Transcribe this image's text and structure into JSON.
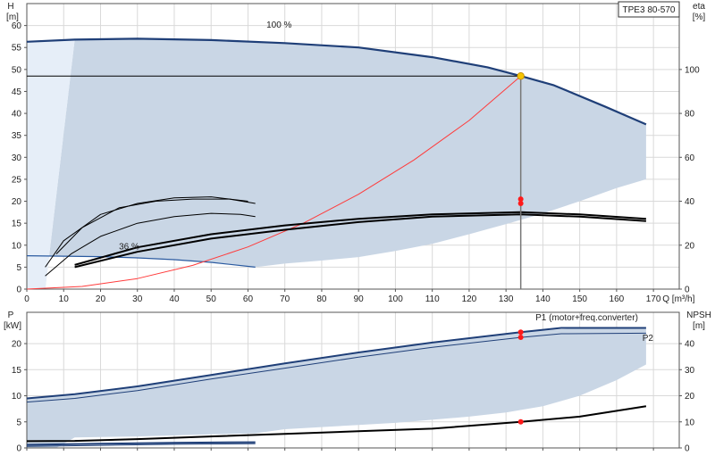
{
  "chart_data": [
    {
      "type": "line",
      "product_label": "TPE3 80-570",
      "ylabel": "H",
      "ylabel_unit": "[m]",
      "y2label": "eta",
      "y2label_unit": "[%]",
      "xlabel": "Q [m³/h]",
      "xlim": [
        0,
        177
      ],
      "ylim": [
        0,
        65
      ],
      "y2lim": [
        0,
        130
      ],
      "xticks": [
        0,
        10,
        20,
        30,
        40,
        50,
        60,
        70,
        80,
        90,
        100,
        110,
        120,
        130,
        140,
        150,
        160,
        170
      ],
      "yticks": [
        0,
        5,
        10,
        15,
        20,
        25,
        30,
        35,
        40,
        45,
        50,
        55,
        60
      ],
      "y2ticks": [
        0,
        20,
        40,
        60,
        80,
        100
      ],
      "grid": true,
      "annotations": [
        {
          "text": "100 %",
          "x": 65,
          "y": 59.5
        },
        {
          "text": "36 %",
          "x": 25,
          "y": 9
        }
      ],
      "operating_point": {
        "x": 134,
        "y": 48.5,
        "color": "#f5c400"
      },
      "operating_area": {
        "color": "#c9d6e5",
        "points": [
          [
            5,
            0
          ],
          [
            13,
            56.8
          ],
          [
            30,
            57
          ],
          [
            50,
            56.7
          ],
          [
            70,
            56
          ],
          [
            90,
            55
          ],
          [
            110,
            52.8
          ],
          [
            125,
            50.5
          ],
          [
            134,
            48.5
          ],
          [
            143,
            46.4
          ],
          [
            157,
            41.5
          ],
          [
            168,
            37.5
          ],
          [
            168,
            25
          ],
          [
            160,
            23
          ],
          [
            150,
            20
          ],
          [
            140,
            17.2
          ],
          [
            130,
            14.8
          ],
          [
            120,
            12.5
          ],
          [
            110,
            10.3
          ],
          [
            100,
            8.7
          ],
          [
            90,
            7.3
          ],
          [
            80,
            6.5
          ],
          [
            70,
            5.8
          ],
          [
            62,
            5
          ],
          [
            50,
            6.1
          ],
          [
            40,
            6.7
          ],
          [
            30,
            7.1
          ],
          [
            20,
            7.4
          ],
          [
            10,
            7.5
          ],
          [
            0,
            7.6
          ],
          [
            0,
            0
          ]
        ]
      },
      "min_area": {
        "color": "#e6eef8",
        "points": [
          [
            0,
            56.3
          ],
          [
            13,
            56.8
          ],
          [
            5,
            0
          ],
          [
            0,
            0
          ]
        ]
      },
      "series": [
        {
          "role": "head_max",
          "axis": "left",
          "color": "#1f3f78",
          "width": 2.2,
          "points": [
            [
              0,
              56.3
            ],
            [
              13,
              56.8
            ],
            [
              30,
              57
            ],
            [
              50,
              56.7
            ],
            [
              70,
              56
            ],
            [
              90,
              55
            ],
            [
              110,
              52.8
            ],
            [
              125,
              50.5
            ],
            [
              134,
              48.5
            ],
            [
              143,
              46.4
            ],
            [
              157,
              41.5
            ],
            [
              168,
              37.5
            ]
          ]
        },
        {
          "role": "head_min",
          "axis": "left",
          "color": "#2a5aa0",
          "width": 1.2,
          "points": [
            [
              0,
              7.6
            ],
            [
              10,
              7.5
            ],
            [
              20,
              7.4
            ],
            [
              30,
              7.1
            ],
            [
              40,
              6.7
            ],
            [
              50,
              6.1
            ],
            [
              62,
              5
            ]
          ]
        },
        {
          "role": "system_curve",
          "axis": "left",
          "color": "#ff3b3b",
          "width": 1,
          "points": [
            [
              0,
              0
            ],
            [
              15,
              0.6
            ],
            [
              30,
              2.4
            ],
            [
              45,
              5.4
            ],
            [
              60,
              9.6
            ],
            [
              75,
              15
            ],
            [
              90,
              21.6
            ],
            [
              105,
              29.4
            ],
            [
              120,
              38.4
            ],
            [
              134,
              48.5
            ]
          ]
        },
        {
          "role": "eta_1",
          "axis": "right",
          "color": "#000000",
          "width": 1,
          "points": [
            [
              5,
              10
            ],
            [
              10,
              22
            ],
            [
              20,
              34
            ],
            [
              30,
              39
            ],
            [
              40,
              41.5
            ],
            [
              50,
              42
            ],
            [
              60,
              40
            ]
          ]
        },
        {
          "role": "eta_2",
          "axis": "right",
          "color": "#000000",
          "width": 1,
          "points": [
            [
              8,
              16
            ],
            [
              15,
              28
            ],
            [
              25,
              37
            ],
            [
              35,
              40
            ],
            [
              45,
              41
            ],
            [
              55,
              41
            ],
            [
              62,
              39
            ]
          ]
        },
        {
          "role": "eta_3",
          "axis": "right",
          "color": "#000000",
          "width": 1,
          "points": [
            [
              5,
              6
            ],
            [
              12,
              16
            ],
            [
              20,
              24
            ],
            [
              30,
              30
            ],
            [
              40,
              33
            ],
            [
              50,
              34.5
            ],
            [
              58,
              34
            ],
            [
              62,
              33
            ]
          ]
        },
        {
          "role": "eta_4",
          "axis": "right",
          "color": "#000000",
          "width": 2,
          "points": [
            [
              13,
              11
            ],
            [
              30,
              19
            ],
            [
              50,
              25
            ],
            [
              70,
              29
            ],
            [
              90,
              32
            ],
            [
              110,
              34
            ],
            [
              134,
              35
            ],
            [
              150,
              34
            ],
            [
              168,
              32
            ]
          ]
        },
        {
          "role": "eta_5",
          "axis": "right",
          "color": "#000000",
          "width": 2,
          "points": [
            [
              13,
              10
            ],
            [
              30,
              17
            ],
            [
              50,
              23
            ],
            [
              70,
              27
            ],
            [
              90,
              30.5
            ],
            [
              110,
              33
            ],
            [
              134,
              34
            ],
            [
              150,
              33
            ],
            [
              168,
              31
            ]
          ]
        }
      ],
      "markers": [
        {
          "x": 134,
          "y2": 41,
          "color": "#ff1a1a"
        },
        {
          "x": 134,
          "y2": 39,
          "color": "#ff1a1a"
        }
      ]
    },
    {
      "type": "line",
      "ylabel": "P",
      "ylabel_unit": "[kW]",
      "y2label": "NPSH",
      "y2label_unit": "[m]",
      "xlim": [
        0,
        177
      ],
      "ylim": [
        0,
        26
      ],
      "y2lim": [
        0,
        52
      ],
      "yticks": [
        0,
        5,
        10,
        15,
        20
      ],
      "y2ticks": [
        0,
        10,
        20,
        30,
        40
      ],
      "grid": true,
      "labels": [
        {
          "text": "P1 (motor+freq.converter)",
          "x": 138,
          "y": 24.5
        },
        {
          "text": "P2",
          "x": 167,
          "y": 20.5
        }
      ],
      "operating_area": {
        "color": "#c9d6e5",
        "points": [
          [
            0,
            9.5
          ],
          [
            13,
            10.3
          ],
          [
            30,
            11.8
          ],
          [
            50,
            14
          ],
          [
            70,
            16.2
          ],
          [
            90,
            18.3
          ],
          [
            110,
            20.2
          ],
          [
            134,
            22.2
          ],
          [
            150,
            23
          ],
          [
            168,
            23
          ],
          [
            168,
            16
          ],
          [
            160,
            13
          ],
          [
            150,
            10
          ],
          [
            140,
            8
          ],
          [
            130,
            6.8
          ],
          [
            120,
            6
          ],
          [
            110,
            5.4
          ],
          [
            100,
            4.8
          ],
          [
            90,
            4.4
          ],
          [
            80,
            4
          ],
          [
            70,
            3.6
          ],
          [
            62,
            2.8
          ],
          [
            50,
            2.6
          ],
          [
            30,
            2.2
          ],
          [
            13,
            2
          ],
          [
            8,
            0
          ],
          [
            0,
            0
          ]
        ]
      },
      "series": [
        {
          "role": "p1_max",
          "axis": "left",
          "color": "#1f3f78",
          "width": 2,
          "points": [
            [
              0,
              9.5
            ],
            [
              13,
              10.3
            ],
            [
              30,
              11.8
            ],
            [
              50,
              14
            ],
            [
              70,
              16.2
            ],
            [
              90,
              18.3
            ],
            [
              110,
              20.2
            ],
            [
              134,
              22.2
            ],
            [
              145,
              23
            ],
            [
              168,
              23
            ]
          ]
        },
        {
          "role": "p2_max",
          "axis": "left",
          "color": "#1f3f78",
          "width": 1,
          "points": [
            [
              0,
              8.8
            ],
            [
              13,
              9.5
            ],
            [
              30,
              11
            ],
            [
              50,
              13.2
            ],
            [
              70,
              15.3
            ],
            [
              90,
              17.4
            ],
            [
              110,
              19.3
            ],
            [
              134,
              21.2
            ],
            [
              145,
              21.9
            ],
            [
              168,
              22
            ]
          ]
        },
        {
          "role": "p_min_1",
          "axis": "left",
          "color": "#1f3f78",
          "width": 2,
          "points": [
            [
              0,
              0.6
            ],
            [
              20,
              0.8
            ],
            [
              40,
              1
            ],
            [
              62,
              1.1
            ]
          ]
        },
        {
          "role": "p_min_2",
          "axis": "left",
          "color": "#1f3f78",
          "width": 1,
          "points": [
            [
              0,
              0.3
            ],
            [
              20,
              0.5
            ],
            [
              40,
              0.7
            ],
            [
              62,
              0.8
            ]
          ]
        },
        {
          "role": "npsh",
          "axis": "right",
          "color": "#000000",
          "width": 2,
          "points": [
            [
              0,
              2.6
            ],
            [
              13,
              2.7
            ],
            [
              30,
              3.4
            ],
            [
              50,
              4.4
            ],
            [
              70,
              5.4
            ],
            [
              90,
              6.4
            ],
            [
              110,
              7.4
            ],
            [
              134,
              10
            ],
            [
              150,
              12
            ],
            [
              168,
              16
            ]
          ]
        }
      ],
      "markers": [
        {
          "x": 134,
          "y": 22.2,
          "color": "#ff1a1a"
        },
        {
          "x": 134,
          "y": 21.2,
          "color": "#ff1a1a"
        },
        {
          "x": 134,
          "y2": 10,
          "color": "#ff1a1a"
        }
      ]
    }
  ]
}
